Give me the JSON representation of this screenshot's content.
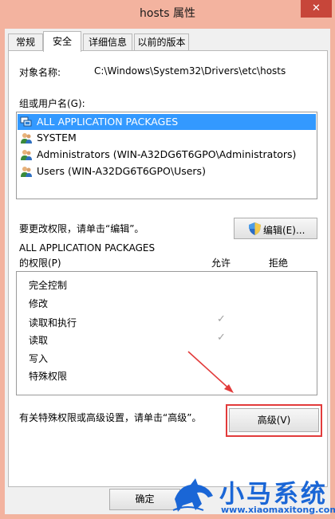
{
  "window": {
    "title": "hosts 属性",
    "close_glyph": "✕"
  },
  "tabs": [
    {
      "label": "常规"
    },
    {
      "label": "安全",
      "active": true
    },
    {
      "label": "详细信息"
    },
    {
      "label": "以前的版本"
    }
  ],
  "security": {
    "object_label": "对象名称:",
    "object_path": "C:\\Windows\\System32\\Drivers\\etc\\hosts",
    "group_label": "组或用户名(G):",
    "users": [
      {
        "name": "ALL APPLICATION PACKAGES",
        "icon": "app-packages-icon",
        "selected": true
      },
      {
        "name": "SYSTEM",
        "icon": "users-icon"
      },
      {
        "name": "Administrators (WIN-A32DG6T6GPO\\Administrators)",
        "icon": "users-icon"
      },
      {
        "name": "Users (WIN-A32DG6T6GPO\\Users)",
        "icon": "users-icon"
      }
    ],
    "change_hint": "要更改权限，请单击“编辑”。",
    "edit_button": "编辑(E)...",
    "perm_for_line1": "ALL APPLICATION PACKAGES",
    "perm_for_line2": "的权限(P)",
    "col_allow": "允许",
    "col_deny": "拒绝",
    "permissions": [
      {
        "name": "完全控制",
        "allow": false,
        "deny": false
      },
      {
        "name": "修改",
        "allow": false,
        "deny": false
      },
      {
        "name": "读取和执行",
        "allow": true,
        "deny": false
      },
      {
        "name": "读取",
        "allow": true,
        "deny": false
      },
      {
        "name": "写入",
        "allow": false,
        "deny": false
      },
      {
        "name": "特殊权限",
        "allow": false,
        "deny": false
      }
    ],
    "check_glyph": "✓",
    "advanced_hint": "有关特殊权限或高级设置，请单击“高级”。",
    "advanced_button": "高级(V)"
  },
  "footer": {
    "ok_button": "确定"
  },
  "watermark": {
    "brand_cn": "小马系统",
    "url": "www.xiaomaxitong.com"
  },
  "colors": {
    "frame": "#f3b39f",
    "selection": "#3399ff",
    "highlight": "#e23b3b",
    "brand_blue": "#1a66d6"
  }
}
